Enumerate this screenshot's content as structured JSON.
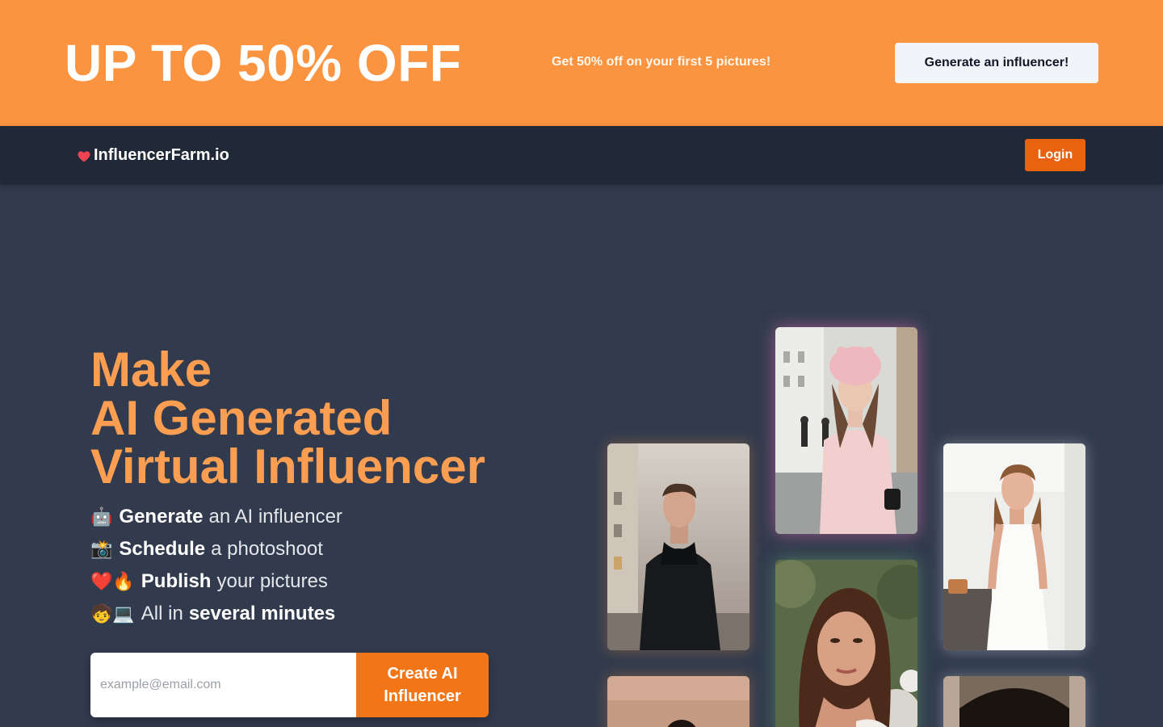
{
  "promo": {
    "headline": "UP TO 50% OFF",
    "subtext": "Get 50% off on your first 5 pictures!",
    "cta_label": "Generate an influencer!"
  },
  "navbar": {
    "brand_name": "InfluencerFarm.io",
    "brand_icon": "heart-icon",
    "login_label": "Login"
  },
  "hero": {
    "title_lines": [
      "Make",
      "AI Generated",
      "Virtual Influencer"
    ],
    "features": [
      {
        "emoji": "🤖",
        "bold": "Generate",
        "rest": "an AI influencer"
      },
      {
        "emoji": "📸",
        "bold": "Schedule",
        "rest": "a photoshoot"
      },
      {
        "emoji": "❤️🔥",
        "bold": "Publish",
        "rest": "your pictures"
      },
      {
        "emoji": "🧒💻",
        "prefix": "All in",
        "bold": "several minutes"
      }
    ]
  },
  "signup": {
    "email_placeholder": "example@email.com",
    "button_label": "Create AI Influencer"
  },
  "colors": {
    "promo_bg": "#fb9441",
    "navbar_bg": "#1f2937",
    "page_bg": "#313b4d",
    "accent": "#e8620f",
    "title": "#fb9e52"
  }
}
